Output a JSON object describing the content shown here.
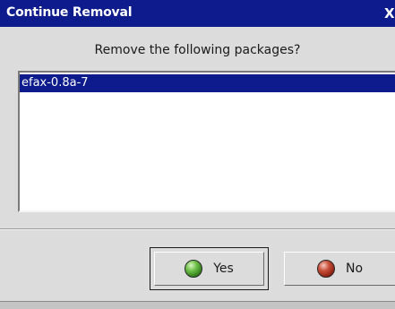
{
  "window": {
    "title": "Continue Removal",
    "close_glyph": "X"
  },
  "dialog": {
    "prompt": "Remove the following packages?",
    "packages": [
      "efax-0.8a-7"
    ]
  },
  "buttons": {
    "yes_label": "Yes",
    "no_label": "No"
  },
  "colors": {
    "titlebar": "#0d1b8c",
    "selection": "#0d1b8c",
    "background": "#dcdcdc"
  }
}
